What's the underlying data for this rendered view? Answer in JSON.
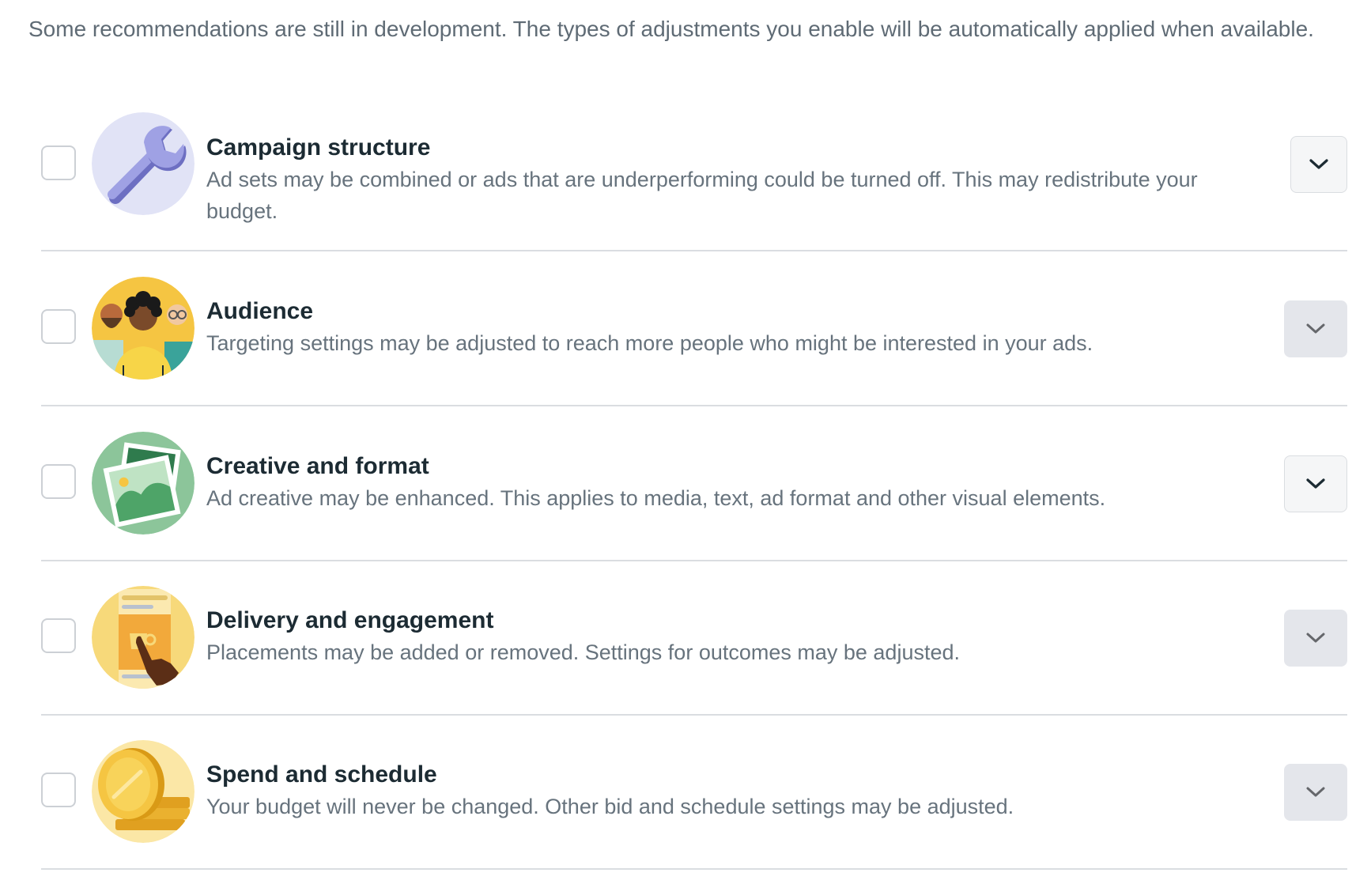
{
  "intro_text": "Some recommendations are still in development. The types of adjustments you enable will be automatically applied when available.",
  "colors": {
    "title": "#1c2b33",
    "description": "#67737d",
    "divider": "#dadde1",
    "button_enabled_bg": "#f5f6f7",
    "button_disabled_bg": "#e4e6eb"
  },
  "items": [
    {
      "title": "Campaign structure",
      "description": "Ad sets may be combined or ads that are underperforming could be turned off. This may redistribute your budget.",
      "icon": "wrench-icon",
      "checked": false,
      "expand_enabled": true
    },
    {
      "title": "Audience",
      "description": "Targeting settings may be adjusted to reach more people who might be interested in your ads.",
      "icon": "people-icon",
      "checked": false,
      "expand_enabled": false
    },
    {
      "title": "Creative and format",
      "description": "Ad creative may be enhanced. This applies to media, text, ad format and other visual elements.",
      "icon": "image-icon",
      "checked": false,
      "expand_enabled": true
    },
    {
      "title": "Delivery and engagement",
      "description": "Placements may be added or removed. Settings for outcomes may be adjusted.",
      "icon": "tap-hand-icon",
      "checked": false,
      "expand_enabled": false
    },
    {
      "title": "Spend and schedule",
      "description": "Your budget will never be changed. Other bid and schedule settings may be adjusted.",
      "icon": "coins-icon",
      "checked": false,
      "expand_enabled": false
    }
  ]
}
